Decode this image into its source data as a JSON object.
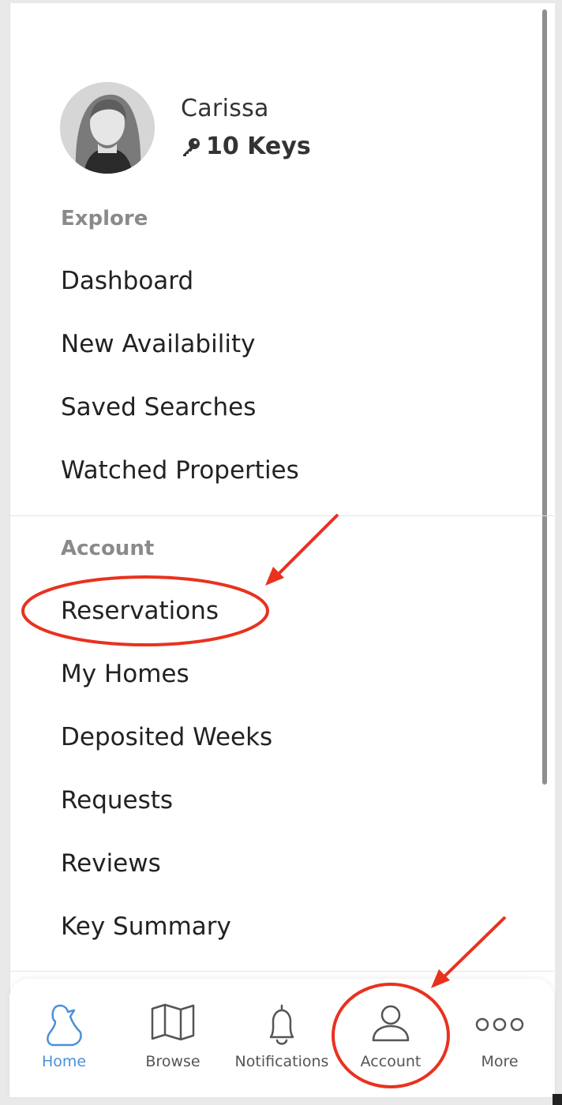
{
  "profile": {
    "name": "Carissa",
    "keys": "10 Keys"
  },
  "explore": {
    "heading": "Explore",
    "items": [
      "Dashboard",
      "New Availability",
      "Saved Searches",
      "Watched Properties"
    ]
  },
  "account": {
    "heading": "Account",
    "items": [
      "Reservations",
      "My Homes",
      "Deposited Weeks",
      "Requests",
      "Reviews",
      "Key Summary"
    ]
  },
  "tabbar": {
    "home": "Home",
    "browse": "Browse",
    "notifications": "Notifications",
    "account": "Account",
    "more": "More"
  },
  "colors": {
    "active_tab": "#4a90d9",
    "annotation": "#e8321f",
    "section_heading": "#8a8a8a"
  }
}
